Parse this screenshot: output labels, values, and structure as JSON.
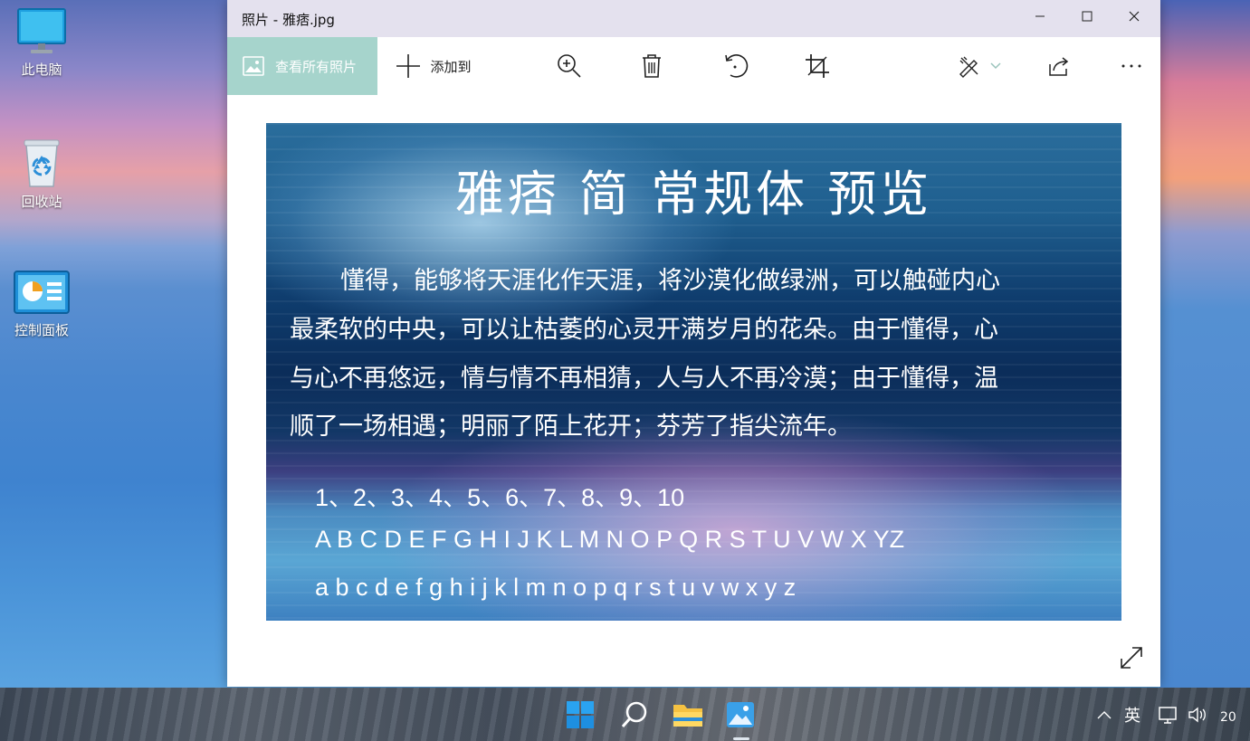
{
  "desktop": {
    "icons": [
      {
        "label": "此电脑",
        "icon": "monitor-icon"
      },
      {
        "label": "回收站",
        "icon": "recycle-bin-icon"
      },
      {
        "label": "控制面板",
        "icon": "control-panel-icon"
      }
    ]
  },
  "window": {
    "title": "照片 - 雅痞.jpg",
    "toolbar": {
      "view_all_label": "查看所有照片",
      "add_to_label": "添加到",
      "icons": [
        "zoom-in-icon",
        "delete-icon",
        "rotate-icon",
        "crop-icon",
        "edit-icon",
        "share-icon",
        "more-icon"
      ]
    }
  },
  "photo": {
    "title": "雅痞 简 常规体 预览",
    "paragraph": [
      "懂得，能够将天涯化作天涯，将沙漠化做绿洲，可以触碰内心",
      "最柔软的中央，可以让枯萎的心灵开满岁月的花朵。由于懂得，心",
      "与心不再悠远，情与情不再相猜，人与人不再冷漠；由于懂得，温",
      "顺了一场相遇；明丽了陌上花开；芬芳了指尖流年。"
    ],
    "numbers": "1、2、3、4、5、6、7、8、9、10",
    "uppercase": "A B C D E F G H I J K L M N O P Q R S T U V W X YZ",
    "lowercase": "a b c d e f g h i j k l m n o p q r s t u v w x y z"
  },
  "taskbar": {
    "apps": [
      "start-icon",
      "search-icon",
      "file-explorer-icon",
      "photos-icon"
    ],
    "tray": {
      "ime": "英",
      "clock_partial": "20"
    }
  },
  "colors": {
    "view_all_bg": "#a6d4cc",
    "titlebar_bg": "#e4e1ee"
  }
}
